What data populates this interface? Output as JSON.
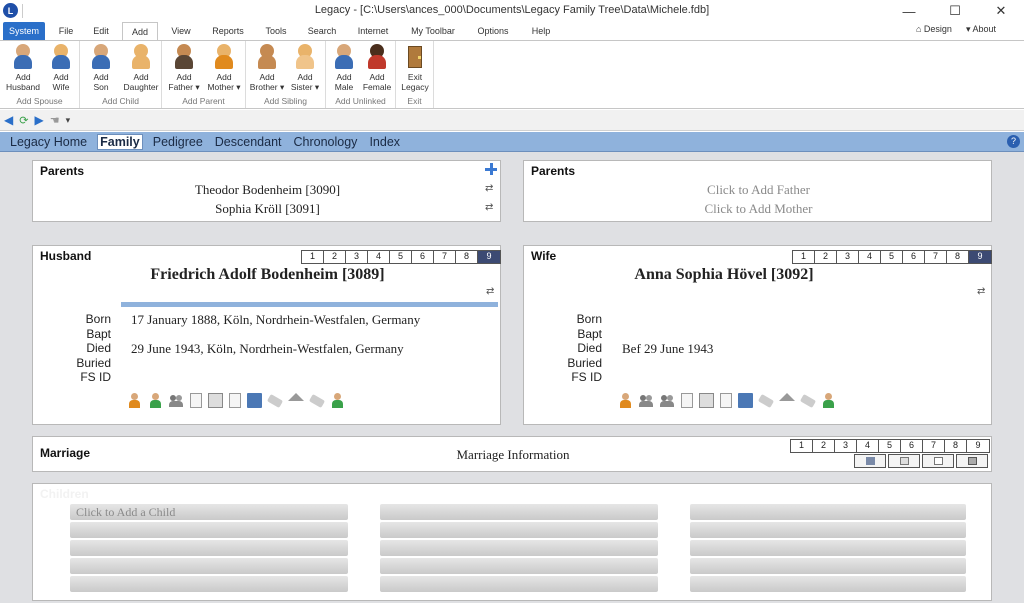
{
  "window": {
    "title": "Legacy - [C:\\Users\\ances_000\\Documents\\Legacy Family Tree\\Data\\Michele.fdb]",
    "app_icon_letter": "L",
    "minimize": "—",
    "maximize": "☐",
    "close": "✕"
  },
  "ribbon_tabs": [
    "System",
    "File",
    "Edit",
    "Add",
    "View",
    "Reports",
    "Tools",
    "Search",
    "Internet",
    "My Toolbar",
    "Options",
    "Help"
  ],
  "ribbon_right": {
    "design": "Design",
    "about": "About"
  },
  "ribbon_groups": {
    "spouse": {
      "label": "Add Spouse",
      "buttons": [
        [
          "Add",
          "Husband"
        ],
        [
          "Add",
          "Wife"
        ]
      ]
    },
    "child": {
      "label": "Add Child",
      "buttons": [
        [
          "Add",
          "Son"
        ],
        [
          "Add",
          "Daughter"
        ]
      ]
    },
    "parent": {
      "label": "Add Parent",
      "buttons": [
        [
          "Add",
          "Father ▾"
        ],
        [
          "Add",
          "Mother ▾"
        ]
      ]
    },
    "sibling": {
      "label": "Add Sibling",
      "buttons": [
        [
          "Add",
          "Brother ▾"
        ],
        [
          "Add",
          "Sister ▾"
        ]
      ]
    },
    "unlinked": {
      "label": "Add Unlinked",
      "buttons": [
        [
          "Add",
          "Male"
        ],
        [
          "Add",
          "Female"
        ]
      ]
    },
    "exit": {
      "label": "Exit",
      "buttons": [
        [
          "Exit",
          "Legacy"
        ]
      ]
    }
  },
  "nav_tabs": [
    "Legacy Home",
    "Family",
    "Pedigree",
    "Descendant",
    "Chronology",
    "Index"
  ],
  "left_parents": {
    "title": "Parents",
    "father": "Theodor Bodenheim [3090]",
    "mother": "Sophia Kröll [3091]"
  },
  "right_parents": {
    "title": "Parents",
    "father": "Click to Add Father",
    "mother": "Click to Add Mother"
  },
  "generation_numbers": [
    "1",
    "2",
    "3",
    "4",
    "5",
    "6",
    "7",
    "8",
    "9"
  ],
  "husband": {
    "title": "Husband",
    "name": "Friedrich Adolf Bodenheim [3089]",
    "events": {
      "born_label": "Born",
      "born": "17 January 1888, Köln, Nordrhein-Westfalen, Germany",
      "bapt_label": "Bapt",
      "bapt": "",
      "died_label": "Died",
      "died": "29 June 1943, Köln, Nordrhein-Westfalen, Germany",
      "buried_label": "Buried",
      "buried": "",
      "fsid_label": "FS ID",
      "fsid": ""
    }
  },
  "wife": {
    "title": "Wife",
    "name": "Anna Sophia Hövel [3092]",
    "events": {
      "born_label": "Born",
      "born": "",
      "bapt_label": "Bapt",
      "bapt": "",
      "died_label": "Died",
      "died": "Bef 29 June 1943",
      "buried_label": "Buried",
      "buried": "",
      "fsid_label": "FS ID",
      "fsid": ""
    }
  },
  "marriage": {
    "title": "Marriage",
    "info": "Marriage Information"
  },
  "children": {
    "title": "Children",
    "add_child": "Click to Add a Child"
  },
  "colors": {
    "nav_bar": "#8fb2dc",
    "system_tab": "#2a6fc9",
    "content_bg": "#dfe0e3",
    "selected_gen": "#3c4a73"
  }
}
